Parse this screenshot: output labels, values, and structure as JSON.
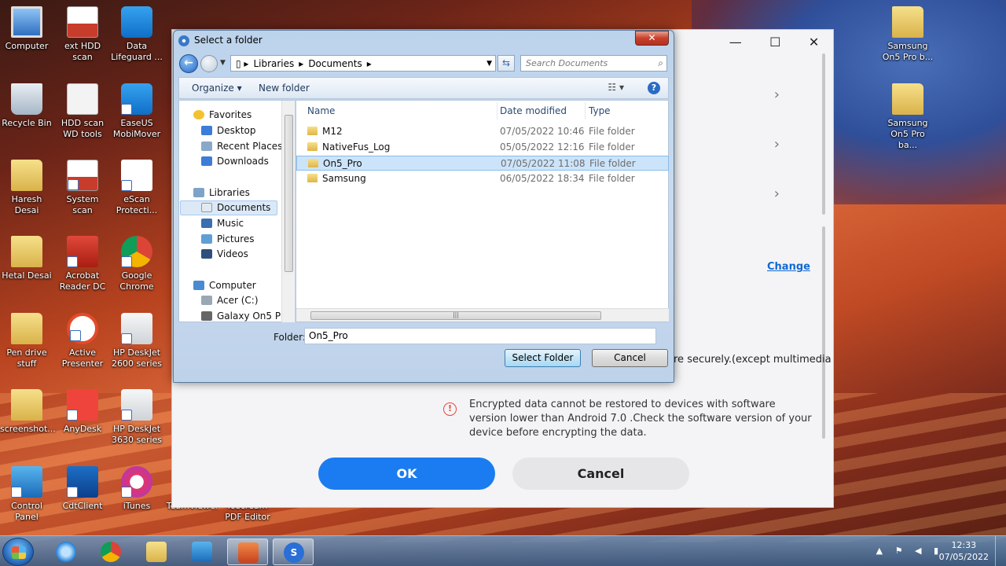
{
  "desktop": {
    "icons": [
      {
        "label": "Computer",
        "kind": "pc"
      },
      {
        "label": "ext HDD scan",
        "kind": "scan"
      },
      {
        "label": "Data Lifeguard ...",
        "kind": "blue"
      },
      {
        "label": "Recycle Bin",
        "kind": "bin"
      },
      {
        "label": "HDD scan WD tools",
        "kind": "white"
      },
      {
        "label": "EaseUS MobiMover",
        "kind": "blue"
      },
      {
        "label": "Haresh Desai",
        "kind": "folder"
      },
      {
        "label": "System scan",
        "kind": "scan"
      },
      {
        "label": "eScan Protecti...",
        "kind": "redshield"
      },
      {
        "label": "Hetal Desai",
        "kind": "folder"
      },
      {
        "label": "Acrobat Reader DC",
        "kind": "red"
      },
      {
        "label": "Google Chrome",
        "kind": "chrome"
      },
      {
        "label": "Pen drive stuff",
        "kind": "folder"
      },
      {
        "label": "Active Presenter",
        "kind": "orange"
      },
      {
        "label": "HP DeskJet 2600 series",
        "kind": "printer"
      },
      {
        "label": "screenshot...",
        "kind": "folder"
      },
      {
        "label": "AnyDesk",
        "kind": "anydesk"
      },
      {
        "label": "HP DeskJet 3630 series",
        "kind": "printer"
      },
      {
        "label": "Control Panel",
        "kind": "cpanel"
      },
      {
        "label": "CdtClient",
        "kind": "cdt"
      },
      {
        "label": "iTunes",
        "kind": "itunes"
      },
      {
        "label": "TeamViewer",
        "kind": "blue"
      },
      {
        "label": "Icecream PDF Editor",
        "kind": "red"
      },
      {
        "label": "Samsung On5 Pro b...",
        "kind": "folder"
      },
      {
        "label": "Samsung On5 Pro ba...",
        "kind": "folder"
      }
    ]
  },
  "app": {
    "change_link": "Change",
    "secure_text": "re securely.(except multimedia",
    "warning_text": "Encrypted data cannot be restored to devices with software version lower than Android 7.0 .Check the software version of your device before encrypting the data.",
    "ok_label": "OK",
    "cancel_label": "Cancel",
    "minimize_glyph": "—",
    "maximize_glyph": "☐",
    "close_glyph": "✕"
  },
  "dialog": {
    "title": "Select a folder",
    "close_glyph": "✕",
    "breadcrumb": [
      "Libraries",
      "Documents"
    ],
    "search_placeholder": "Search Documents",
    "toolbar": {
      "organize": "Organize ▾",
      "new_folder": "New folder",
      "help": "?"
    },
    "nav": {
      "favorites": "Favorites",
      "desktop": "Desktop",
      "recent": "Recent Places",
      "downloads": "Downloads",
      "libraries": "Libraries",
      "documents": "Documents",
      "music": "Music",
      "pictures": "Pictures",
      "videos": "Videos",
      "computer": "Computer",
      "acer": "Acer (C:)",
      "galaxy": "Galaxy On5 Pro"
    },
    "columns": {
      "name": "Name",
      "date": "Date modified",
      "type": "Type"
    },
    "files": [
      {
        "name": "M12",
        "date": "07/05/2022 10:46",
        "type": "File folder"
      },
      {
        "name": "NativeFus_Log",
        "date": "05/05/2022 12:16",
        "type": "File folder"
      },
      {
        "name": "On5_Pro",
        "date": "07/05/2022 11:08",
        "type": "File folder"
      },
      {
        "name": "Samsung",
        "date": "06/05/2022 18:34",
        "type": "File folder"
      }
    ],
    "selected_index": 2,
    "folder_label": "Folder:",
    "folder_value": "On5_Pro",
    "select_button": "Select Folder",
    "cancel_button": "Cancel"
  },
  "taskbar": {
    "time": "12:33",
    "date": "07/05/2022"
  }
}
